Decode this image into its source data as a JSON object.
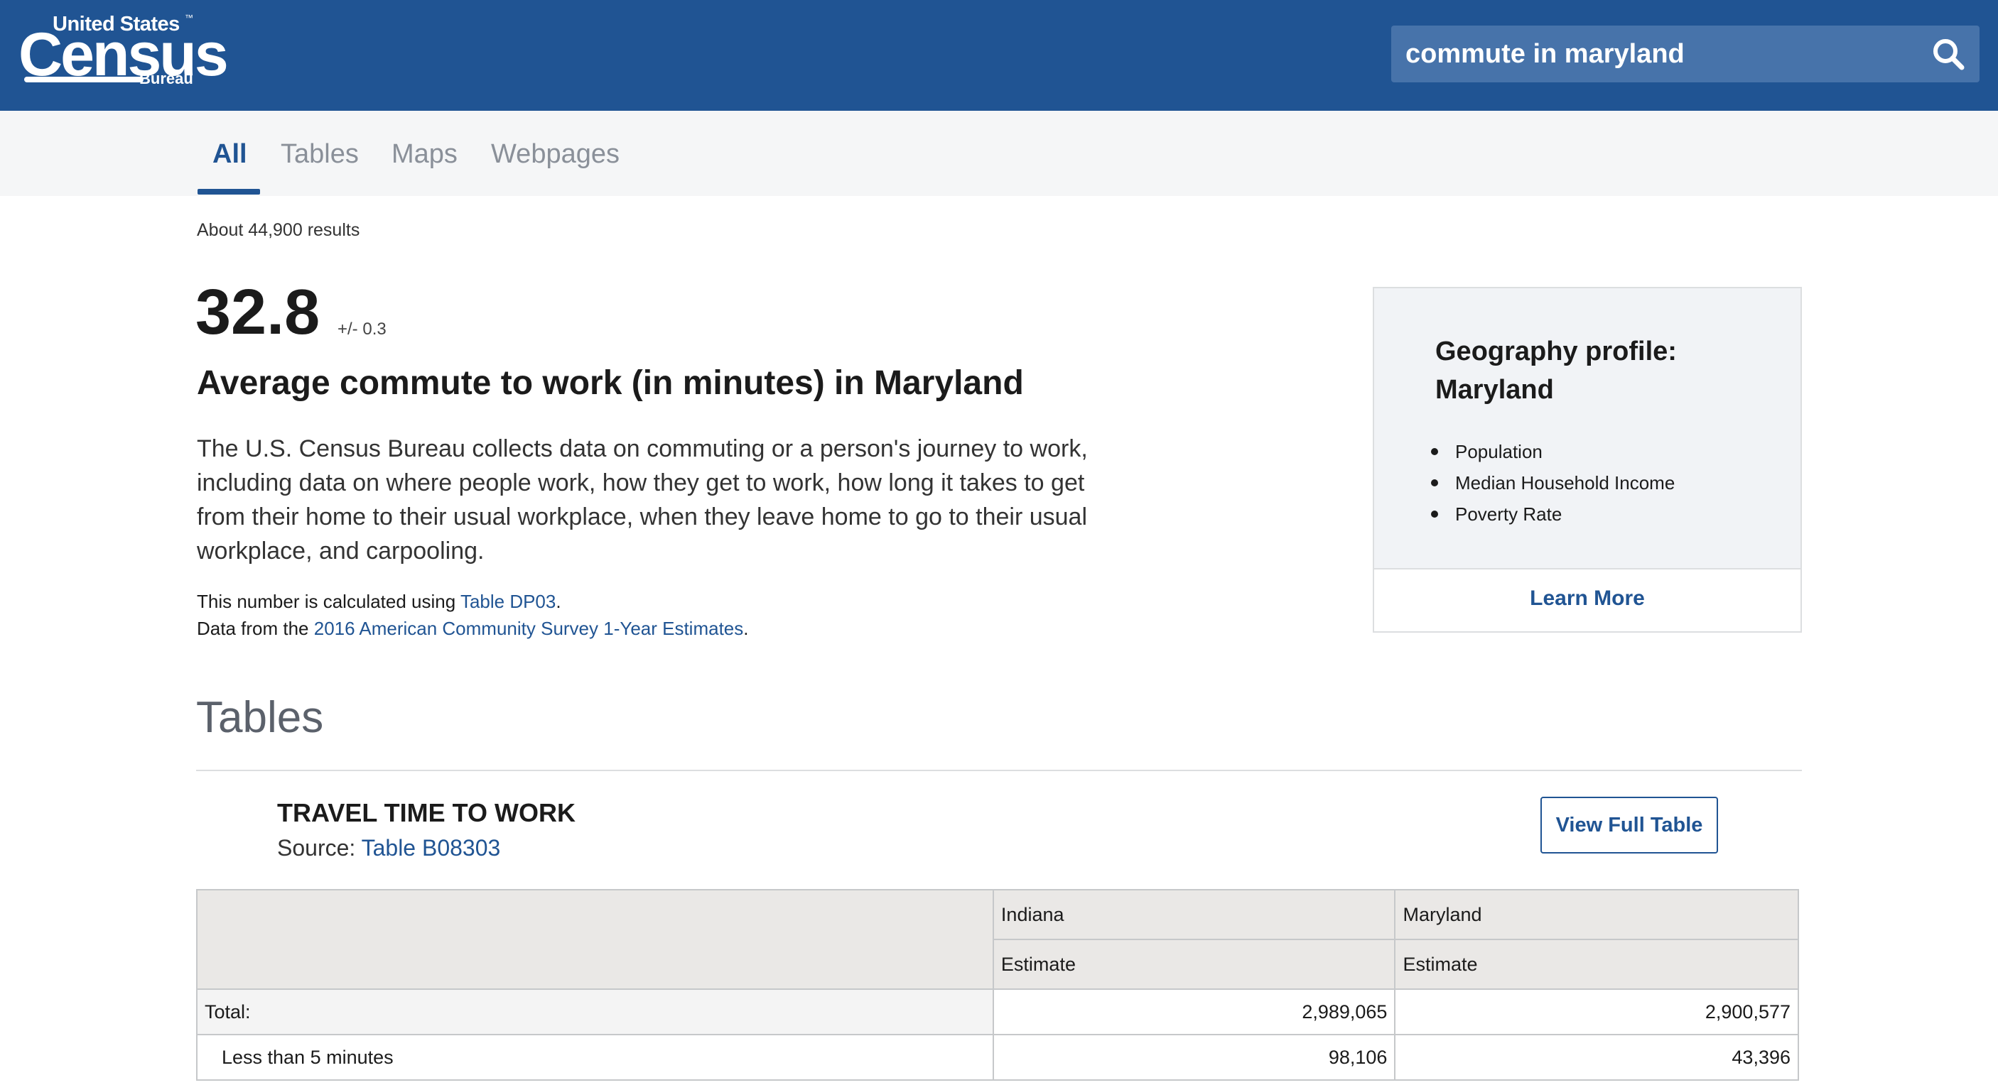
{
  "header": {
    "logo": {
      "united_states": "United States",
      "census": "Census",
      "bureau": "Bureau",
      "tm": "™"
    },
    "search": {
      "value": "commute in maryland",
      "icon": "search-icon"
    },
    "colors": {
      "brand": "#205493",
      "search_bg": "#4773aa"
    }
  },
  "tabs": [
    {
      "label": "All",
      "active": true
    },
    {
      "label": "Tables",
      "active": false
    },
    {
      "label": "Maps",
      "active": false
    },
    {
      "label": "Webpages",
      "active": false
    }
  ],
  "results": {
    "count_text": "About 44,900 results"
  },
  "answer": {
    "value": "32.8",
    "margin": "+/- 0.3",
    "title": "Average commute to work (in minutes) in Maryland",
    "description": "The U.S. Census Bureau collects data on commuting or a person's journey to work, including data on where people work, how they get to work, how long it takes to get from their home to their usual workplace, when they leave home to go to their usual workplace, and carpooling.",
    "calc_prefix": "This number is calculated using ",
    "calc_link": "Table DP03",
    "calc_suffix": ".",
    "data_prefix": "Data from the ",
    "data_link": "2016 American Community Survey 1-Year Estimates",
    "data_suffix": "."
  },
  "geo_card": {
    "title": "Geography profile: Maryland",
    "items": [
      "Population",
      "Median Household Income",
      "Poverty Rate"
    ],
    "learn_more": "Learn More"
  },
  "tables_section": {
    "heading": "Tables",
    "table_title": "TRAVEL TIME TO WORK",
    "source_prefix": "Source: ",
    "source_link": "Table B08303",
    "view_full": "View Full Table",
    "columns": [
      "Indiana",
      "Maryland"
    ],
    "sub_columns": [
      "Estimate",
      "Estimate"
    ],
    "rows": [
      {
        "label": "Total:",
        "indiana": "2,989,065",
        "maryland": "2,900,577"
      },
      {
        "label": "Less than 5 minutes",
        "indiana": "98,106",
        "maryland": "43,396"
      }
    ]
  }
}
